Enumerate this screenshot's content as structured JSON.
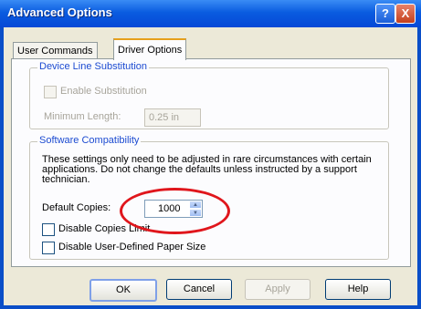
{
  "window": {
    "title": "Advanced Options",
    "help_glyph": "?",
    "close_glyph": "X"
  },
  "tabs": [
    {
      "label": "User Commands",
      "active": false
    },
    {
      "label": "Driver Options",
      "active": true
    }
  ],
  "device_line": {
    "title": "Device Line Substitution",
    "enable_label": "Enable Substitution",
    "min_length_label": "Minimum Length:",
    "min_length_value": "0.25 in"
  },
  "software": {
    "title": "Software Compatibility",
    "description": "These settings only need to be adjusted in rare circumstances with certain applications.  Do not change the defaults unless instructed by a support technician.",
    "default_copies_label": "Default Copies:",
    "default_copies_value": "1000",
    "disable_copies_label": "Disable Copies Limit",
    "disable_paper_label": "Disable User-Defined Paper Size"
  },
  "buttons": {
    "ok": "OK",
    "cancel": "Cancel",
    "apply": "Apply",
    "help": "Help"
  },
  "colors": {
    "titlebar": "#0a5ce0",
    "annotation": "#e0161c"
  }
}
